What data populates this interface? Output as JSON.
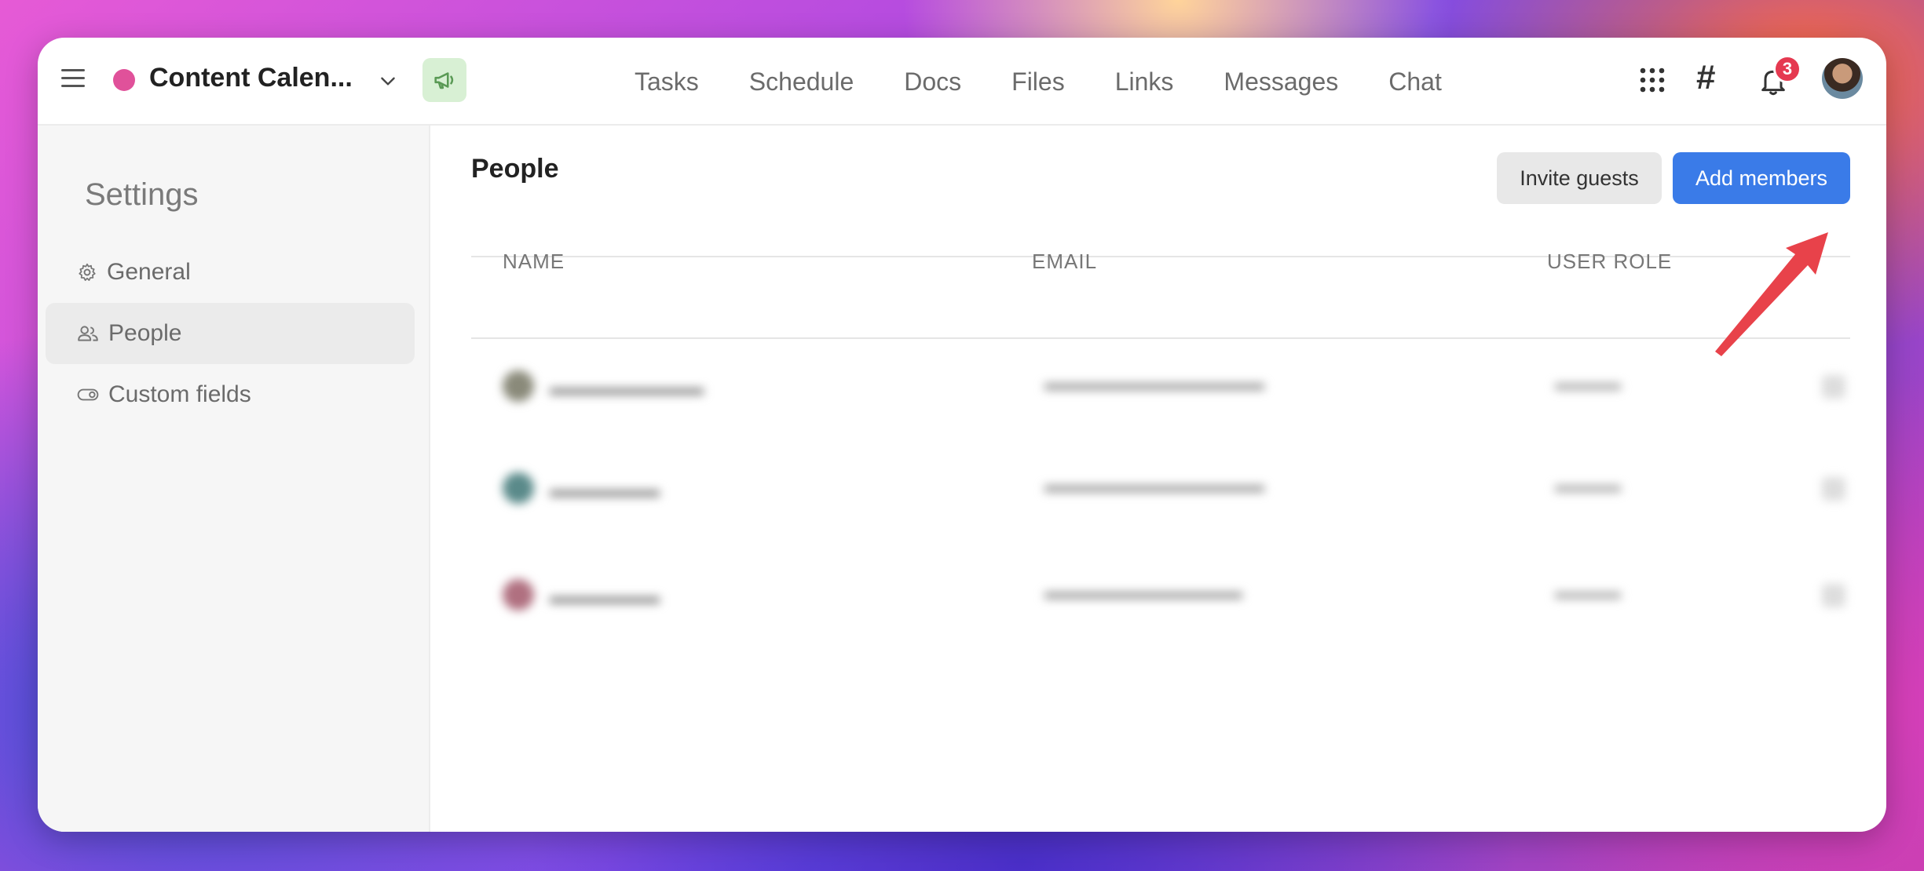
{
  "topbar": {
    "project_name": "Content Calen...",
    "project_color": "#e0519a",
    "nav": [
      "Tasks",
      "Schedule",
      "Docs",
      "Files",
      "Links",
      "Messages",
      "Chat"
    ],
    "notification_count": "3",
    "icons": [
      "menu-icon",
      "chevron-down-icon",
      "megaphone-icon",
      "apps-grid-icon",
      "hashtag-icon",
      "bell-icon",
      "avatar"
    ]
  },
  "sidebar": {
    "title": "Settings",
    "items": [
      {
        "label": "General",
        "icon": "gear-icon"
      },
      {
        "label": "People",
        "icon": "people-icon",
        "active": true
      },
      {
        "label": "Custom fields",
        "icon": "toggle-icon"
      }
    ]
  },
  "main": {
    "title": "People",
    "invite_label": "Invite guests",
    "add_label": "Add members",
    "accent_color": "#3a7be8",
    "columns": [
      "NAME",
      "EMAIL",
      "USER ROLE"
    ]
  }
}
